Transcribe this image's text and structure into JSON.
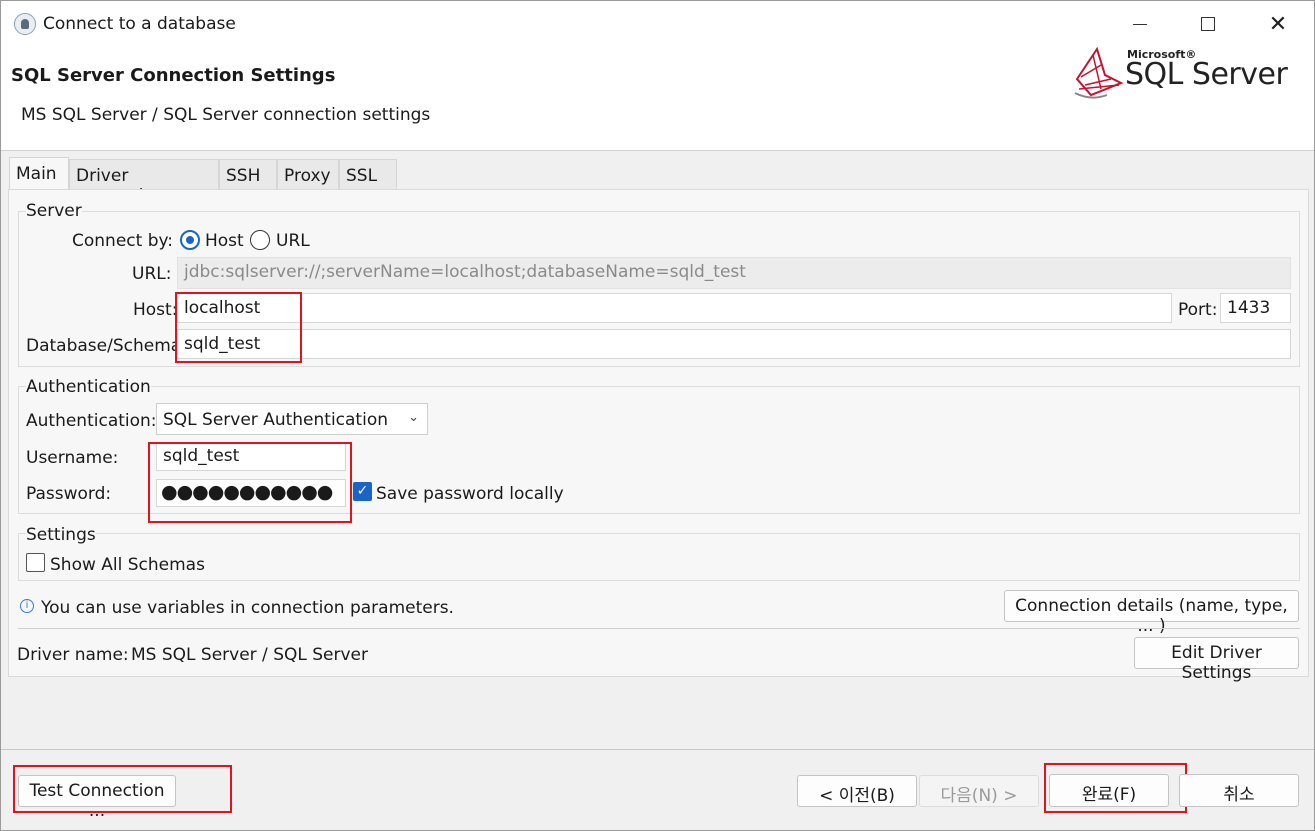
{
  "window": {
    "title": "Connect to a database",
    "controls": {
      "minimize": "minimize",
      "maximize": "maximize",
      "close": "✕"
    }
  },
  "header": {
    "title": "SQL Server Connection Settings",
    "subtitle": "MS SQL Server / SQL Server connection settings",
    "logo_brand": "Microsoft®",
    "logo_product": "SQL Server"
  },
  "tabs": [
    {
      "label": "Main",
      "active": true
    },
    {
      "label": "Driver properties",
      "active": false
    },
    {
      "label": "SSH",
      "active": false
    },
    {
      "label": "Proxy",
      "active": false
    },
    {
      "label": "SSL",
      "active": false
    }
  ],
  "server": {
    "group_label": "Server",
    "connect_by_label": "Connect by:",
    "connect_by_options": [
      "Host",
      "URL"
    ],
    "connect_by_selected": "Host",
    "url_label": "URL:",
    "url_value": "jdbc:sqlserver://;serverName=localhost;databaseName=sqld_test",
    "host_label": "Host:",
    "host_value": "localhost",
    "port_label": "Port:",
    "port_value": "1433",
    "database_label": "Database/Schema:",
    "database_value": "sqld_test"
  },
  "authentication": {
    "group_label": "Authentication",
    "auth_label": "Authentication:",
    "auth_value": "SQL Server Authentication",
    "username_label": "Username:",
    "username_value": "sqld_test",
    "password_label": "Password:",
    "password_value": "●●●●●●●●●●●",
    "save_password_label": "Save password locally",
    "save_password_checked": true
  },
  "settings": {
    "group_label": "Settings",
    "show_all_schemas_label": "Show All Schemas",
    "show_all_schemas_checked": false
  },
  "info": {
    "icon": "info-icon",
    "text": "You can use variables in connection parameters.",
    "details_button": "Connection details (name, type, ... )"
  },
  "driver": {
    "label": "Driver name:",
    "value": "MS SQL Server / SQL Server",
    "edit_button": "Edit Driver Settings"
  },
  "footer": {
    "test_connection": "Test Connection ...",
    "back": "< 이전(B)",
    "next": "다음(N) >",
    "finish": "완료(F)",
    "cancel": "취소"
  },
  "colors": {
    "highlight": "#e0141e",
    "accent": "#1a64c8"
  }
}
